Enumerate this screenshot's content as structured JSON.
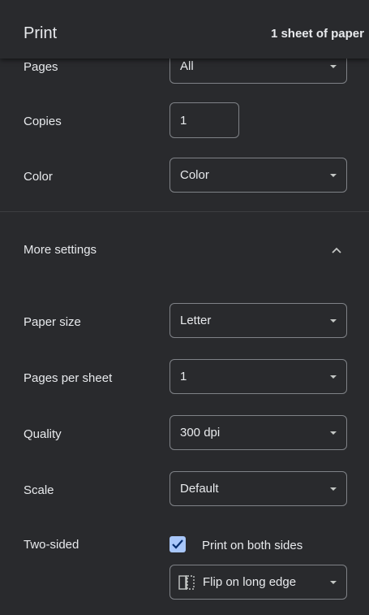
{
  "header": {
    "title": "Print",
    "sheet_count": "1 sheet of paper"
  },
  "settings": {
    "pages": {
      "label": "Pages",
      "value": "All"
    },
    "copies": {
      "label": "Copies",
      "value": "1"
    },
    "color": {
      "label": "Color",
      "value": "Color"
    },
    "more_settings": {
      "label": "More settings",
      "expanded": true
    },
    "paper_size": {
      "label": "Paper size",
      "value": "Letter"
    },
    "pages_per_sheet": {
      "label": "Pages per sheet",
      "value": "1"
    },
    "quality": {
      "label": "Quality",
      "value": "300 dpi"
    },
    "scale": {
      "label": "Scale",
      "value": "Default"
    },
    "two_sided": {
      "label": "Two-sided",
      "checkbox_label": "Print on both sides",
      "checked": true,
      "flip_value": "Flip on long edge"
    }
  },
  "icons": {
    "dropdown": "chevron-down-icon",
    "collapse": "chevron-up-icon",
    "check": "check-icon",
    "flip": "flip-long-edge-icon"
  },
  "colors": {
    "background": "#292a2d",
    "text": "#e8eaed",
    "border": "#7f8287",
    "checkbox_accent": "#a8c7fa"
  }
}
